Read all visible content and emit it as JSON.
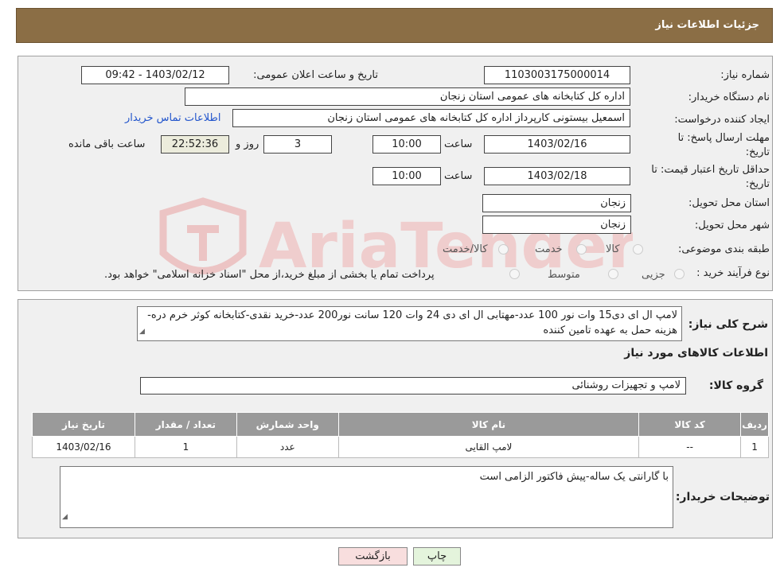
{
  "header": {
    "title": "جزئیات اطلاعات نیاز"
  },
  "form": {
    "need_number_label": "شماره نیاز:",
    "need_number": "1103003175000014",
    "announce_label": "تاریخ و ساعت اعلان عمومی:",
    "announce_value": "1403/02/12 - 09:42",
    "buyer_org_label": "نام دستگاه خریدار:",
    "buyer_org": "اداره کل کتابخانه های عمومی استان زنجان",
    "creator_label": "ایجاد کننده درخواست:",
    "creator": "اسمعیل بیستونی کارپرداز اداره کل کتابخانه های عمومی استان زنجان",
    "contact_link": "اطلاعات تماس خریدار",
    "deadline_label_1": "مهلت ارسال پاسخ: تا",
    "deadline_label_2": "تاریخ:",
    "deadline_date": "1403/02/16",
    "time_label": "ساعت",
    "deadline_time": "10:00",
    "days_value": "3",
    "days_label": "روز و",
    "remaining_time": "22:52:36",
    "remaining_label": "ساعت باقی مانده",
    "validity_label_1": "حداقل تاریخ اعتبار قیمت: تا",
    "validity_label_2": "تاریخ:",
    "validity_date": "1403/02/18",
    "validity_time": "10:00",
    "province_label": "استان محل تحویل:",
    "province": "زنجان",
    "city_label": "شهر محل تحویل:",
    "city": "زنجان",
    "category_label": "طبقه بندی موضوعی:",
    "category_options": [
      "کالا",
      "خدمت",
      "کالا/خدمت"
    ],
    "purchase_type_label": "نوع فرآیند خرید :",
    "purchase_options": [
      "جزیی",
      "متوسط"
    ],
    "purchase_note": "پرداخت تمام یا بخشی از مبلغ خرید،از محل \"اسناد خزانه اسلامی\" خواهد بود."
  },
  "details": {
    "summary_label": "شرح کلی نیاز:",
    "summary_text": "لامپ ال ای دی15 وات نور 100 عدد-مهتابی ال ای دی 24 وات 120 سانت نور200 عدد-خرید نقدی-کتابخانه کوثر خرم دره-هزینه حمل به عهده تامین کننده",
    "goods_info_title": "اطلاعات کالاهای مورد نیاز",
    "goods_group_label": "گروه کالا:",
    "goods_group": "لامپ و تجهیزات روشنائی",
    "table": {
      "headers": [
        "ردیف",
        "کد کالا",
        "نام کالا",
        "واحد شمارش",
        "تعداد / مقدار",
        "تاریخ نیاز"
      ],
      "rows": [
        [
          "1",
          "--",
          "لامپ القایی",
          "عدد",
          "1",
          "1403/02/16"
        ]
      ]
    },
    "buyer_notes_label": "توضیحات خریدار:",
    "buyer_notes": "با گارانتی یک ساله-پیش فاکتور الزامی است"
  },
  "buttons": {
    "print": "چاپ",
    "back": "بازگشت"
  },
  "watermark": {
    "text": "AriaTender.neT",
    "color": "#e8b4b4"
  }
}
